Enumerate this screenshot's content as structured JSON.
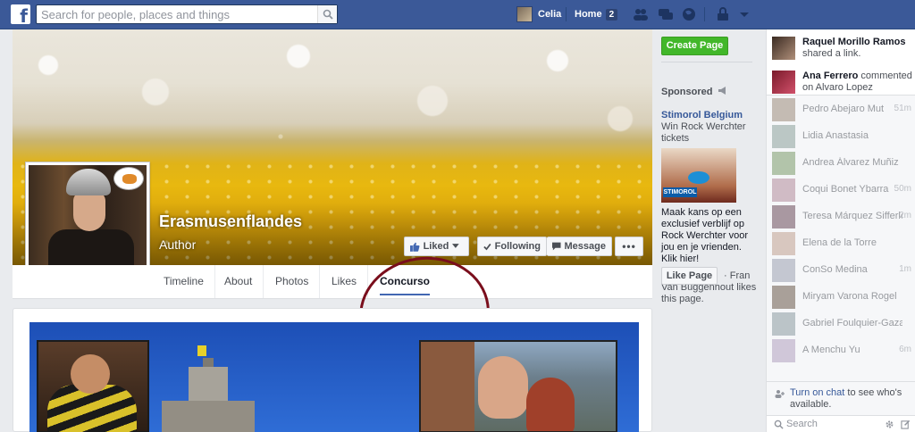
{
  "topbar": {
    "search_placeholder": "Search for people, places and things",
    "user_name": "Celia",
    "home_label": "Home",
    "home_count": "2"
  },
  "page": {
    "name": "Erasmusenflandes",
    "category": "Author",
    "liked_label": "Liked",
    "following_label": "Following",
    "message_label": "Message",
    "more_label": "•••",
    "tabs": [
      {
        "label": "Timeline"
      },
      {
        "label": "About"
      },
      {
        "label": "Photos"
      },
      {
        "label": "Likes"
      },
      {
        "label": "Concurso"
      }
    ]
  },
  "ads": {
    "create_page_label": "Create Page",
    "sponsored_label": "Sponsored",
    "ad_title": "Stimorol Belgium",
    "ad_subtitle": "Win Rock Werchter tickets",
    "ad_image_logo": "STIMOROL",
    "ad_body": "Maak kans op een exclusief verblijf op Rock Werchter voor jou en je vrienden. Klik hier!",
    "like_page_label": "Like Page",
    "social_text": "· Fran Van Buggenhout likes this page."
  },
  "ticker": [
    {
      "name": "Raquel Morillo Ramos",
      "action": "shared a link."
    },
    {
      "name": "Ana Ferrero",
      "action": "commented on Alvaro Lopez Ramirez's"
    }
  ],
  "friends": [
    {
      "name": "Pedro Abejaro Mut",
      "time": "51m"
    },
    {
      "name": "Lidia Anastasia",
      "time": ""
    },
    {
      "name": "Andrea Álvarez Muñiz",
      "time": ""
    },
    {
      "name": "Coqui Bonet Ybarra",
      "time": "50m"
    },
    {
      "name": "Teresa Márquez Sifferle",
      "time": "2m"
    },
    {
      "name": "Elena de la Torre",
      "time": ""
    },
    {
      "name": "ConSo Medina",
      "time": "1m"
    },
    {
      "name": "Miryam Varona Rogel",
      "time": ""
    },
    {
      "name": "Gabriel Foulquier-Gazagnes",
      "time": ""
    },
    {
      "name": "A Menchu Yu",
      "time": "6m"
    }
  ],
  "chat": {
    "turn_on_link": "Turn on chat",
    "turn_on_rest": " to see who's available.",
    "search_placeholder": "Search"
  },
  "colors": {
    "brand": "#3b5998",
    "link": "#365899",
    "create_page": "#42b72a",
    "annotation_circle": "#7a0e1c"
  }
}
